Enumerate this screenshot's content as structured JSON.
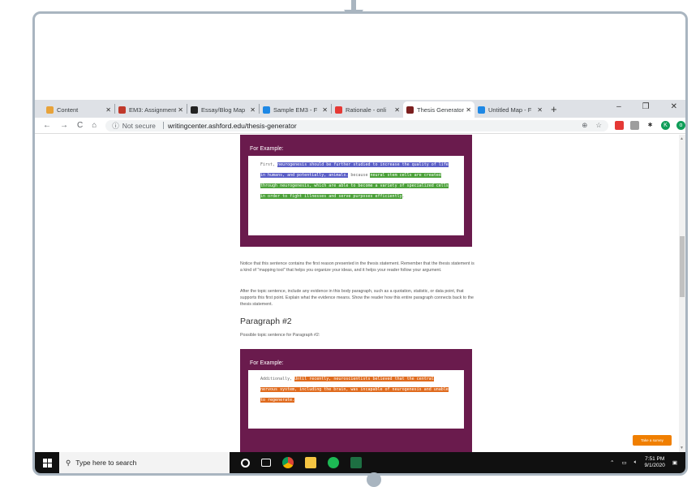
{
  "tabs": [
    {
      "label": "Content",
      "color": "#e8a33a"
    },
    {
      "label": "EM3: Assignment",
      "color": "#c0392b"
    },
    {
      "label": "Essay/Blog Map",
      "color": "#222222"
    },
    {
      "label": "Sample EM3 - F",
      "color": "#1e88e5"
    },
    {
      "label": "Rationale - onli",
      "color": "#e53935"
    },
    {
      "label": "Thesis Generator",
      "color": "#7b1f1f",
      "active": true
    },
    {
      "label": "Untitled Map - F",
      "color": "#1e88e5"
    }
  ],
  "address": {
    "security": "Not secure",
    "url": "writingcenter.ashford.edu/thesis-generator"
  },
  "example1": {
    "label": "For Example:",
    "prefix": "First, ",
    "hl1": "neurogenesis should be further studied to increase the quality of life in humans, and potentially, animals.",
    "mid": " because ",
    "hl2": "neural stem cells are created through neurogenesis, which are able to become a variety of specialized cells in order to fight illnesses and serve purposes efficiently",
    "suffix": "."
  },
  "para1": "Notice that this sentence contains the first reason presented in the thesis statement. Remember that the thesis statement is a kind of \"mapping tool\" that helps you organize your ideas, and it helps your reader follow your argument.",
  "para2": "After the topic sentence, include any evidence in this body paragraph, such as a quotation, statistic, or data point, that supports this first point. Explain what the evidence means. Show the reader how this entire paragraph connects back to the thesis statement.",
  "heading2": "Paragraph #2",
  "para3": "Possible topic sentence for Paragraph #2:",
  "example2": {
    "label": "For Example:",
    "prefix": "Additionally, ",
    "hl": "Until recently, neuroscientists believed that the central nervous system, including the brain, was incapable of neurogenesis and unable to regenerate."
  },
  "survey": "Take a survey",
  "taskbar": {
    "search_placeholder": "Type here to search",
    "time": "7:51 PM",
    "date": "9/1/2020"
  }
}
